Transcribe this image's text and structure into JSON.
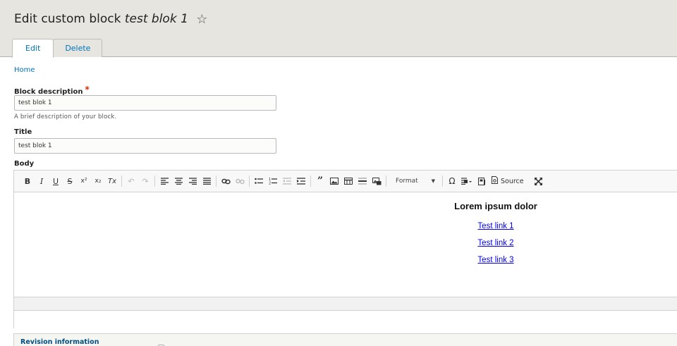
{
  "header": {
    "title_prefix": "Edit custom block",
    "title_entity": "test blok 1",
    "star_icon": "☆",
    "tabs": [
      {
        "label": "Edit",
        "active": true
      },
      {
        "label": "Delete",
        "active": false
      }
    ]
  },
  "breadcrumb": {
    "home": "Home"
  },
  "form": {
    "block_description": {
      "label": "Block description",
      "required_mark": "*",
      "value": "test blok 1",
      "help": "A brief description of your block."
    },
    "title": {
      "label": "Title",
      "value": "test blok 1"
    },
    "body": {
      "label": "Body"
    }
  },
  "editor": {
    "toolbar": {
      "bold": "B",
      "italic": "I",
      "underline": "U",
      "strike": "S",
      "superscript": "x²",
      "subscript": "x₂",
      "remove_format": "Tx",
      "undo": "↶",
      "redo": "↷",
      "format_label": "Format",
      "special_char": "Ω",
      "source_label": "Source"
    },
    "content": {
      "heading": "Lorem ipsum dolor",
      "links": [
        "Test link 1",
        "Test link 2",
        "Test link 3"
      ]
    }
  },
  "revision": {
    "label": "Revision information"
  },
  "colors": {
    "accent": "#0074bd",
    "header_bg": "#e6e5df",
    "required": "#e62600",
    "link": "#0000ee"
  }
}
